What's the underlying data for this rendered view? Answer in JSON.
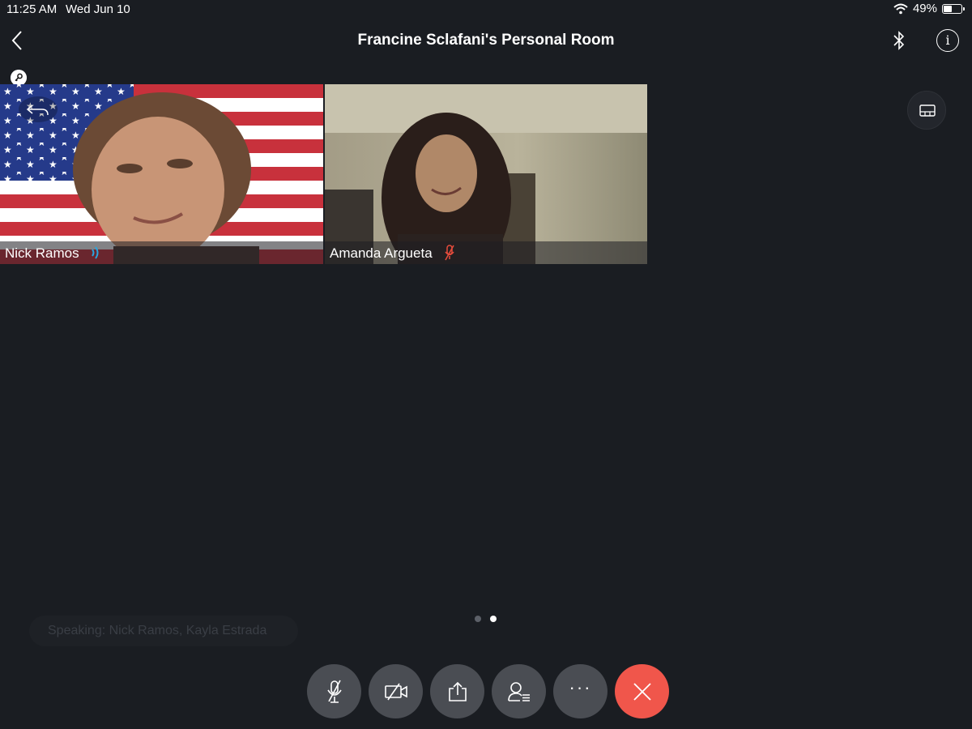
{
  "status_bar": {
    "time": "11:25 AM",
    "date": "Wed Jun 10",
    "battery_percent_label": "49%",
    "battery_level": 0.49
  },
  "header": {
    "title": "Francine Sclafani's Personal Room",
    "icons": [
      "chevron-left-icon",
      "bluetooth-icon",
      "info-icon"
    ]
  },
  "participants": [
    {
      "name": "Nick Ramos",
      "audio_state": "speaking"
    },
    {
      "name": "Amanda Argueta",
      "audio_state": "muted"
    }
  ],
  "page_indicator": {
    "pages": 2,
    "current": 2
  },
  "speaking_banner": "Speaking: Nick Ramos, Kayla Estrada",
  "controls": {
    "more_label": "···",
    "icons": [
      "mute-microphone-icon",
      "video-off-icon",
      "share-icon",
      "participants-icon",
      "more-icon",
      "end-call-icon"
    ]
  },
  "colors": {
    "background": "#1a1d22",
    "control_button": "#4a4d53",
    "end_call": "#f0564b",
    "speaking_indicator": "#2aa5e0",
    "muted_indicator": "#e74c3c"
  }
}
